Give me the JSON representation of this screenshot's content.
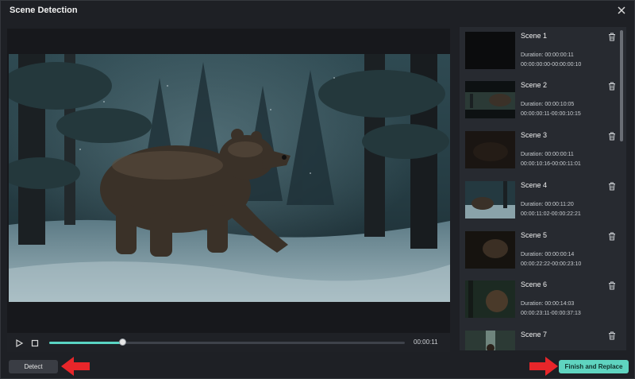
{
  "window": {
    "title": "Scene Detection"
  },
  "player": {
    "timecode": "00:00:11",
    "progress": 0.205
  },
  "scenes": [
    {
      "name": "Scene 1",
      "duration": "Duration: 00:00:00:11",
      "range": "00:00:00:00-00:00:00:10"
    },
    {
      "name": "Scene 2",
      "duration": "Duration: 00:00:10:05",
      "range": "00:00:00:11-00:00:10:15"
    },
    {
      "name": "Scene 3",
      "duration": "Duration: 00:00:00:11",
      "range": "00:00:10:16-00:00:11:01"
    },
    {
      "name": "Scene 4",
      "duration": "Duration: 00:00:11:20",
      "range": "00:00:11:02-00:00:22:21"
    },
    {
      "name": "Scene 5",
      "duration": "Duration: 00:00:00:14",
      "range": "00:00:22:22-00:00:23:10"
    },
    {
      "name": "Scene 6",
      "duration": "Duration: 00:00:14:03",
      "range": "00:00:23:11-00:00:37:13"
    },
    {
      "name": "Scene 7",
      "duration": "",
      "range": ""
    }
  ],
  "buttons": {
    "detect": "Detect",
    "finish": "Finish and Replace"
  },
  "colors": {
    "accent": "#5fd4c0",
    "arrow": "#e8262a",
    "background": "#1e2025"
  },
  "icons": {
    "close": "close-icon",
    "play": "play-icon",
    "stop": "stop-icon",
    "trash": "trash-icon",
    "arrow": "red-arrow-icon"
  }
}
